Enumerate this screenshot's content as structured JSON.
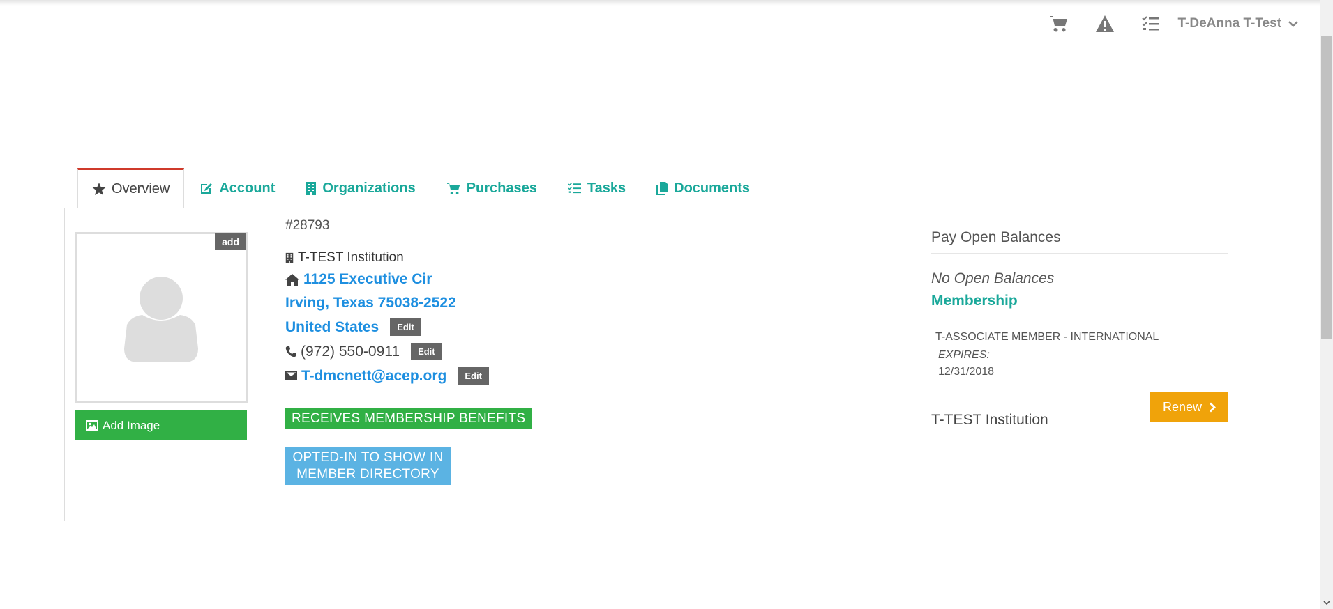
{
  "topnav": {
    "icons": [
      "cart-icon",
      "warning-icon",
      "tasks-icon"
    ],
    "user_name": "T-DeAnna T-Test"
  },
  "tabs": [
    {
      "label": "Overview",
      "icon": "star-icon",
      "active": true
    },
    {
      "label": "Account",
      "icon": "edit-icon",
      "active": false
    },
    {
      "label": "Organizations",
      "icon": "building-icon",
      "active": false
    },
    {
      "label": "Purchases",
      "icon": "cart-icon",
      "active": false
    },
    {
      "label": "Tasks",
      "icon": "tasks-icon",
      "active": false
    },
    {
      "label": "Documents",
      "icon": "documents-icon",
      "active": false
    }
  ],
  "profile": {
    "avatar_add_label": "add",
    "add_image_label": "Add Image",
    "member_id": "#28793",
    "institution": "T-TEST Institution",
    "address_line1": "1125 Executive Cir",
    "address_line2": "Irving, Texas 75038-2522",
    "country": "United States",
    "phone": "(972) 550-0911",
    "email": "T-dmcnett@acep.org",
    "edit_label": "Edit",
    "badge_benefits": "RECEIVES MEMBERSHIP BENEFITS",
    "badge_directory": "OPTED-IN TO SHOW IN MEMBER DIRECTORY"
  },
  "balances": {
    "title": "Pay Open Balances",
    "no_balances": "No Open Balances",
    "membership_heading": "Membership",
    "membership_type": "T-ASSOCIATE MEMBER - INTERNATIONAL",
    "expires_label": "EXPIRES:",
    "expires_date": "12/31/2018",
    "renew_label": "Renew",
    "organization": "T-TEST Institution"
  },
  "colors": {
    "teal": "#1aa89a",
    "link_blue": "#1e8fe0",
    "green": "#31b045",
    "blue_badge": "#5bb3e3",
    "renew_orange": "#f0a30a",
    "active_tab_red": "#cf3a2b"
  }
}
